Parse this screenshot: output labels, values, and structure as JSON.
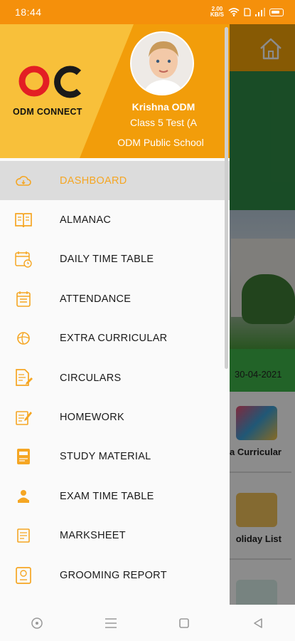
{
  "status_bar": {
    "time": "18:44",
    "speed_top": "2.00",
    "speed_bottom": "KB/S"
  },
  "colors": {
    "accent": "#f5a623",
    "header_orange": "#f29d0a",
    "header_yellow": "#f8c03a",
    "active_bg": "#dcdcdc"
  },
  "background_app": {
    "date": "30-04-2021",
    "card_1_label": "a Curricular",
    "card_2_label": "oliday List"
  },
  "drawer": {
    "logo_text": "ODM CONNECT",
    "user_name": "Krishna ODM",
    "user_class": "Class  5 Test (A",
    "user_school": "ODM Public School",
    "items": [
      {
        "label": "DASHBOARD",
        "icon": "cloud-icon",
        "active": true
      },
      {
        "label": "ALMANAC",
        "icon": "book-icon",
        "active": false
      },
      {
        "label": "DAILY TIME TABLE",
        "icon": "calendar-clock-icon",
        "active": false
      },
      {
        "label": "ATTENDANCE",
        "icon": "calendar-icon",
        "active": false
      },
      {
        "label": "EXTRA CURRICULAR",
        "icon": "ball-icon",
        "active": false
      },
      {
        "label": "CIRCULARS",
        "icon": "document-pen-icon",
        "active": false
      },
      {
        "label": "HOMEWORK",
        "icon": "notepad-pencil-icon",
        "active": false
      },
      {
        "label": "STUDY MATERIAL",
        "icon": "study-book-icon",
        "active": false
      },
      {
        "label": "EXAM TIME TABLE",
        "icon": "student-desk-icon",
        "active": false
      },
      {
        "label": "MARKSHEET",
        "icon": "sheet-icon",
        "active": false
      },
      {
        "label": "GROOMING REPORT",
        "icon": "report-badge-icon",
        "active": false
      }
    ]
  }
}
